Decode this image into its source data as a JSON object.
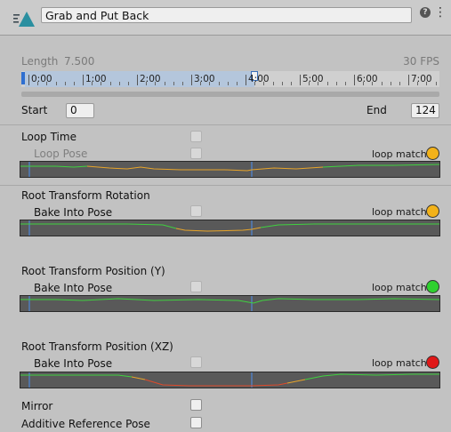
{
  "header": {
    "clip_name": "Grab and Put Back",
    "icon": "animation-clip-icon",
    "help_icon": "help-icon",
    "menu_icon": "kebab-menu-icon"
  },
  "clip_info": {
    "length_label": "Length",
    "length_value": "7.500",
    "fps": "30 FPS"
  },
  "timeline": {
    "labels": [
      "0:00",
      "1:00",
      "2:00",
      "3:00",
      "4:00",
      "5:00",
      "6:00",
      "7:00"
    ],
    "selection_end_label": "4:00"
  },
  "range": {
    "start_label": "Start",
    "start_value": "0",
    "end_label": "End",
    "end_value": "124"
  },
  "sections": {
    "loop_time": {
      "label": "Loop Time",
      "sub_label": "Loop Pose",
      "loop_match_label": "loop match",
      "lamp_color": "#f2b21a"
    },
    "root_rotation": {
      "label": "Root Transform Rotation",
      "sub_label": "Bake Into Pose",
      "loop_match_label": "loop match",
      "lamp_color": "#f2b21a"
    },
    "root_position_y": {
      "label": "Root Transform Position (Y)",
      "sub_label": "Bake Into Pose",
      "loop_match_label": "loop match",
      "lamp_color": "#2fd12f"
    },
    "root_position_xz": {
      "label": "Root Transform Position (XZ)",
      "sub_label": "Bake Into Pose",
      "loop_match_label": "loop match",
      "lamp_color": "#e01818"
    }
  },
  "footer": {
    "mirror_label": "Mirror",
    "additive_label": "Additive Reference Pose"
  },
  "colors": {
    "curve_green": "#3fd23f",
    "curve_orange": "#e8a52a",
    "curve_red": "#e04a2a",
    "cursor_blue": "#4f86d6"
  }
}
